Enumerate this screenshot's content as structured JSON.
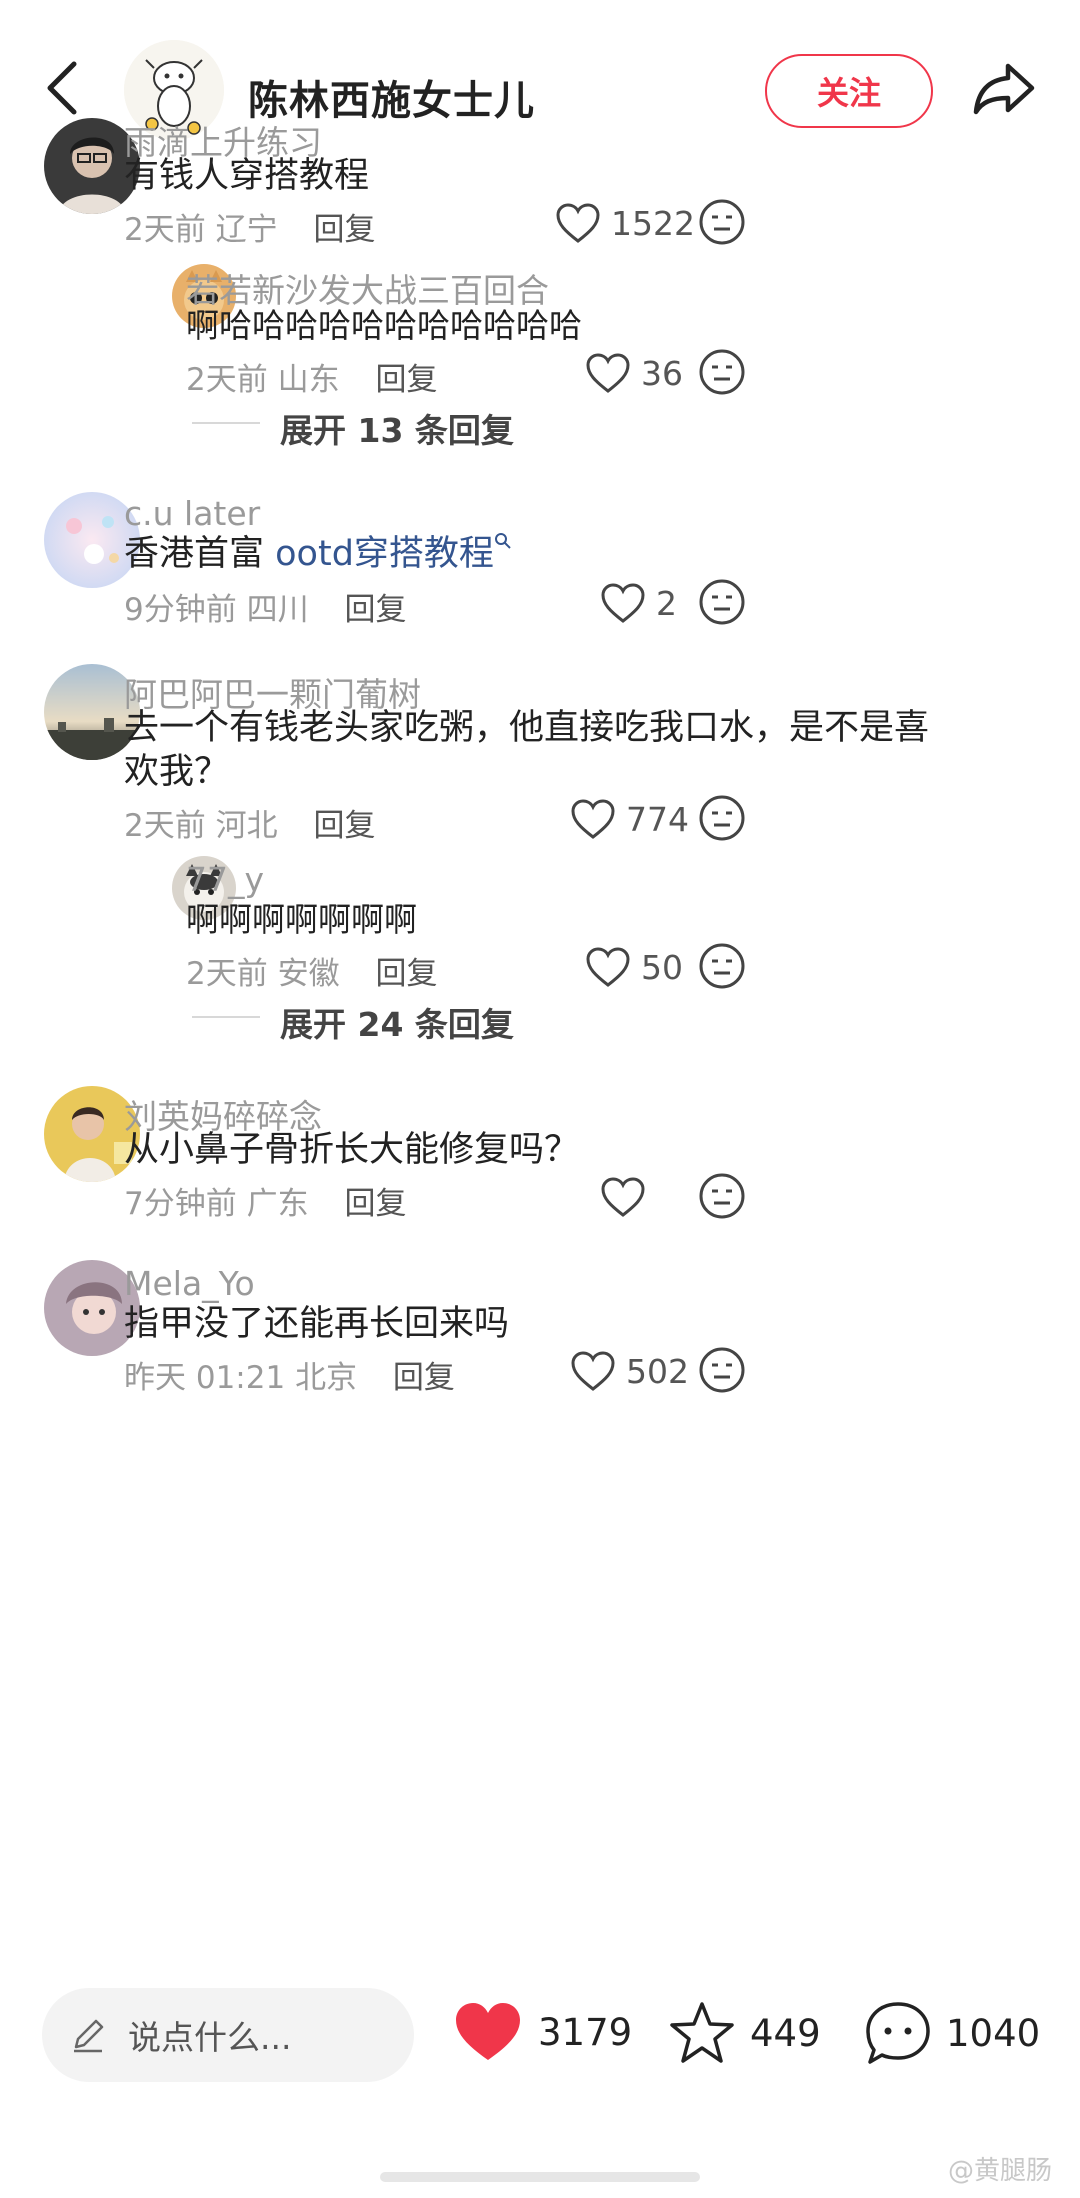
{
  "header": {
    "title": "陈林西施女士儿",
    "follow_label": "关注"
  },
  "comments": [
    {
      "user": "雨滴上升练习",
      "text": "有钱人穿搭教程",
      "time": "2天前",
      "location": "辽宁",
      "reply_label": "回复",
      "likes": "1522",
      "replies": [
        {
          "user": "若若新沙发大战三百回合",
          "text": "啊哈哈哈哈哈哈哈哈哈哈哈",
          "time": "2天前",
          "location": "山东",
          "reply_label": "回复",
          "likes": "36"
        }
      ],
      "expand_label": "展开 13 条回复"
    },
    {
      "user": "c.u later",
      "text_prefix": "香港首富 ",
      "text_link": "ootd穿搭教程",
      "time": "9分钟前",
      "location": "四川",
      "reply_label": "回复",
      "likes": "2"
    },
    {
      "user": "阿巴阿巴一颗门葡树",
      "text_line1": "去一个有钱老头家吃粥，他直接吃我口水，是不是喜",
      "text_line2": "欢我？",
      "time": "2天前",
      "location": "河北",
      "reply_label": "回复",
      "likes": "774",
      "replies": [
        {
          "user": "77_y",
          "text": "啊啊啊啊啊啊啊",
          "time": "2天前",
          "location": "安徽",
          "reply_label": "回复",
          "likes": "50"
        }
      ],
      "expand_label": "展开 24 条回复"
    },
    {
      "user": "刘英妈碎碎念",
      "text": "从小鼻子骨折长大能修复吗？",
      "time": "7分钟前",
      "location": "广东",
      "reply_label": "回复",
      "likes": ""
    },
    {
      "user": "Mela_Yo",
      "text": "指甲没了还能再长回来吗",
      "time": "昨天 01:21",
      "location": "北京",
      "reply_label": "回复",
      "likes": "502"
    }
  ],
  "bottom_bar": {
    "input_placeholder": "说点什么...",
    "likes": "3179",
    "favorites": "449",
    "comments": "1040"
  },
  "watermark": "@黄腿肠",
  "colors": {
    "accent": "#f0364a",
    "link": "#34558f",
    "secondary_text": "#9a9a9a"
  }
}
